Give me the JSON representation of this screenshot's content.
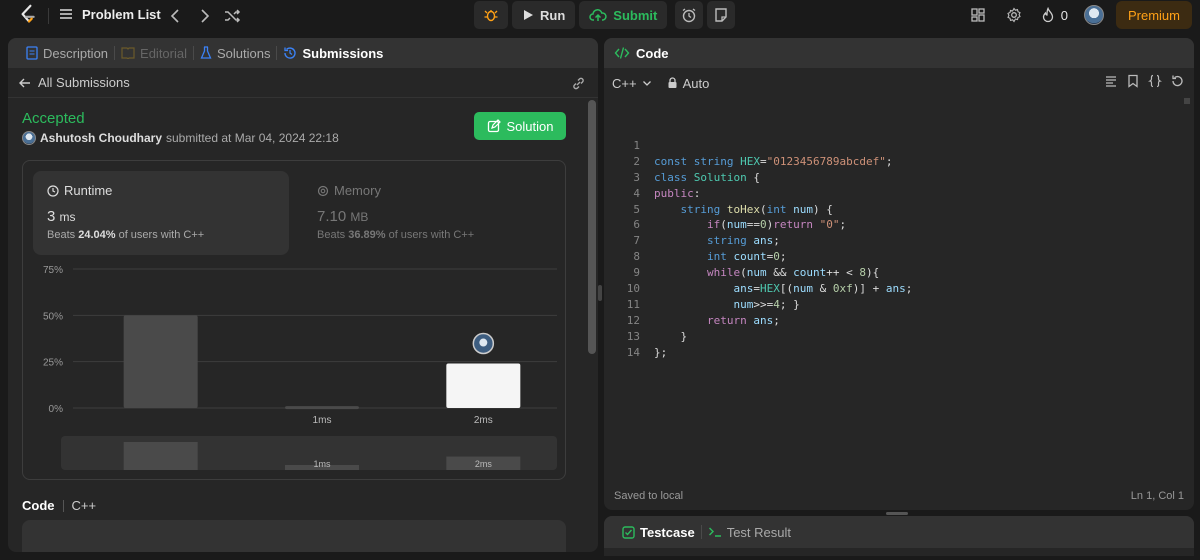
{
  "topbar": {
    "problem_list": "Problem List",
    "run_label": "Run",
    "submit_label": "Submit",
    "streak_count": "0",
    "premium_label": "Premium"
  },
  "left": {
    "tabs": {
      "description": "Description",
      "editorial": "Editorial",
      "solutions": "Solutions",
      "submissions": "Submissions"
    },
    "back_label": "All Submissions",
    "status": "Accepted",
    "author": "Ashutosh Choudhary",
    "submitted_text": "submitted at Mar 04, 2024 22:18",
    "solution_button": "Solution",
    "runtime": {
      "label": "Runtime",
      "value": "3",
      "unit": "ms",
      "beats_prefix": "Beats",
      "beats_pct": "24.04%",
      "beats_suffix": "of users with C++"
    },
    "memory": {
      "label": "Memory",
      "value": "7.10",
      "unit": "MB",
      "beats_prefix": "Beats",
      "beats_pct": "36.89%",
      "beats_suffix": "of users with C++"
    },
    "code_label": "Code",
    "code_lang": "C++"
  },
  "chart_data": {
    "type": "bar",
    "categories": [
      "",
      "1ms",
      "2ms"
    ],
    "values": [
      50,
      1,
      24
    ],
    "y_ticks": [
      "75%",
      "50%",
      "25%",
      "0%"
    ],
    "ylim": [
      0,
      75
    ],
    "highlighted_category": "2ms",
    "grid": true
  },
  "editor": {
    "title": "Code",
    "language": "C++",
    "mode": "Auto",
    "status": "Saved to local",
    "cursor": "Ln 1, Col 1",
    "lines": [
      "",
      "const string HEX=\"0123456789abcdef\";",
      "class Solution {",
      "public:",
      "    string toHex(int num) {",
      "        if(num==0)return \"0\";",
      "        string ans;",
      "        int count=0;",
      "        while(num && count++ < 8){",
      "            ans=HEX[(num & 0xf)] + ans;",
      "            num>>=4; }",
      "        return ans;",
      "    }",
      "};"
    ]
  },
  "bottom": {
    "testcase_label": "Testcase",
    "result_label": "Test Result"
  },
  "colors": {
    "accent_green": "#2cbb5d",
    "premium_orange": "#ffa116",
    "panel_bg": "#262626"
  }
}
